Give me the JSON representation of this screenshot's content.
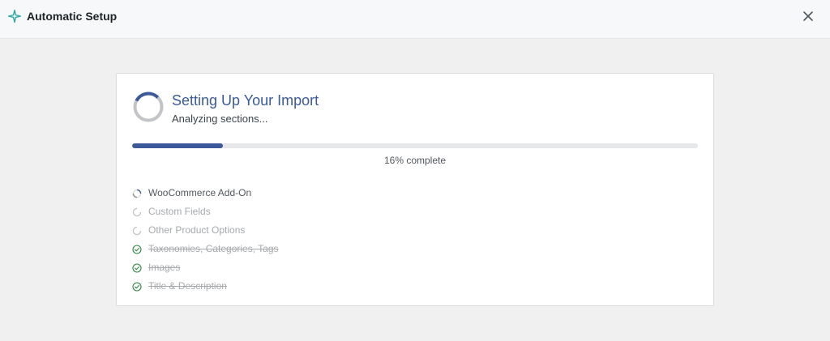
{
  "header": {
    "title": "Automatic Setup",
    "icon": "sparkle-icon",
    "accent": "#2aa7a0"
  },
  "card": {
    "title": "Setting Up Your Import",
    "subtitle": "Analyzing sections...",
    "progress": {
      "value": 16,
      "label": "16% complete",
      "color": "#3c5a9a"
    },
    "steps": [
      {
        "label": "WooCommerce Add-On",
        "status": "active"
      },
      {
        "label": "Custom Fields",
        "status": "pending"
      },
      {
        "label": "Other Product Options",
        "status": "pending"
      },
      {
        "label": "Taxonomies, Categories, Tags",
        "status": "done"
      },
      {
        "label": "Images",
        "status": "done"
      },
      {
        "label": "Title & Description",
        "status": "done"
      }
    ]
  },
  "colors": {
    "success": "#2e8540",
    "title": "#3a5a9b"
  }
}
